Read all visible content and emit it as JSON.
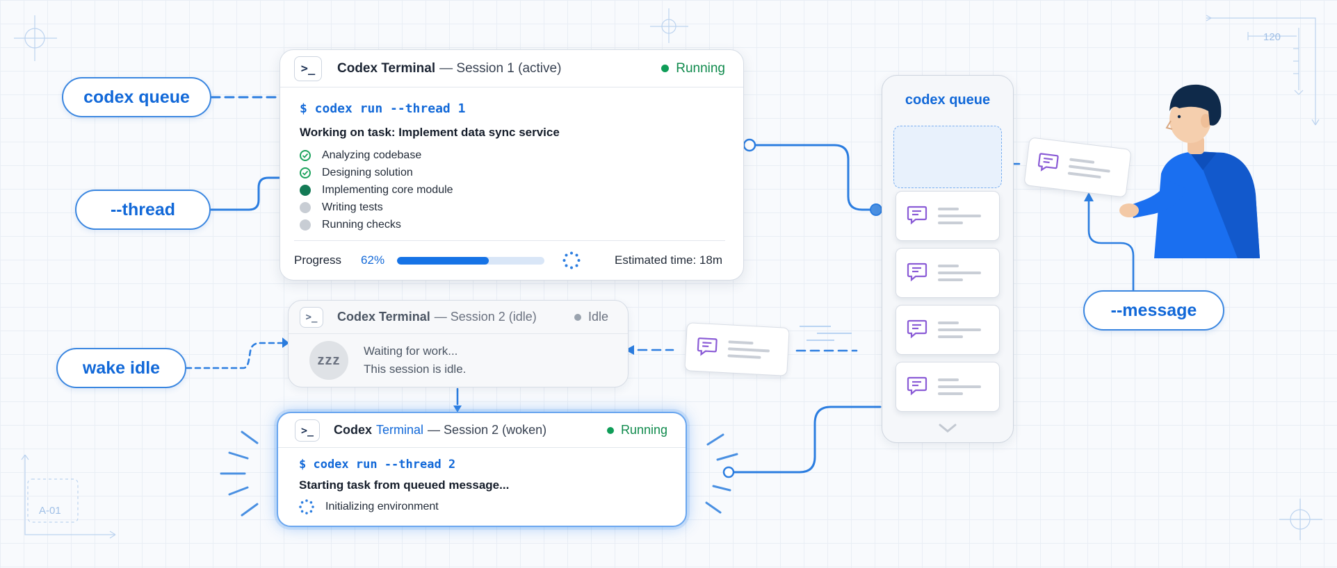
{
  "labels": {
    "codex_queue": "codex queue",
    "thread": "--thread",
    "wake_idle": "wake idle",
    "message": "--message"
  },
  "session1": {
    "title_strong": "Codex Terminal",
    "title_rest": "— Session 1 (active)",
    "status": "Running",
    "command": "$ codex run --thread 1",
    "task": "Working on task: Implement data sync service",
    "steps": [
      {
        "label": "Analyzing codebase",
        "state": "done"
      },
      {
        "label": "Designing solution",
        "state": "done"
      },
      {
        "label": "Implementing core module",
        "state": "active"
      },
      {
        "label": "Writing tests",
        "state": "pending"
      },
      {
        "label": "Running checks",
        "state": "pending"
      }
    ],
    "progress_label": "Progress",
    "progress_value": "62%",
    "progress_fraction": 0.62,
    "eta": "Estimated time: 18m"
  },
  "session2_idle": {
    "title_strong": "Codex Terminal",
    "title_rest": "— Session 2 (idle)",
    "status": "Idle",
    "badge": "zzz",
    "line1": "Waiting for work...",
    "line2": "This session is idle."
  },
  "session2_woken": {
    "title_codex": "Codex",
    "title_terminal": "Terminal",
    "title_rest": "— Session 2 (woken)",
    "status": "Running",
    "command": "$ codex run --thread 2",
    "task": "Starting task from queued message...",
    "step": "Initializing environment"
  },
  "queue": {
    "title": "codex queue",
    "message_count": 4
  },
  "decor": {
    "ruler_value": "120",
    "corner_tag": "A-01"
  },
  "colors": {
    "accent": "#1168d8",
    "running": "#0f9d58",
    "idle": "#9aa3ae",
    "message_icon": "#8a5bd6"
  }
}
